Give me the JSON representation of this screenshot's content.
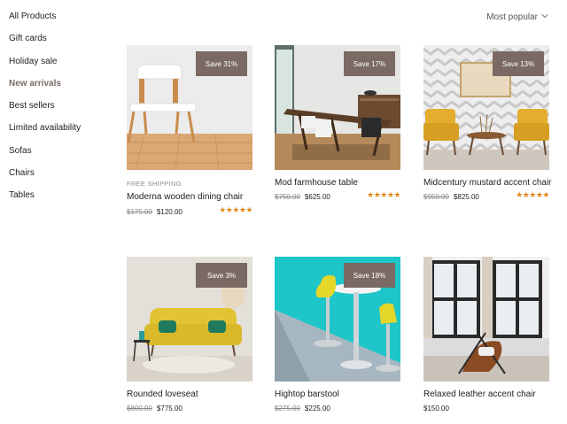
{
  "sidebar": {
    "items": [
      {
        "label": "All Products"
      },
      {
        "label": "Gift cards"
      },
      {
        "label": "Holiday sale"
      },
      {
        "label": "New arrivals"
      },
      {
        "label": "Best sellers"
      },
      {
        "label": "Limited availability"
      },
      {
        "label": "Sofas"
      },
      {
        "label": "Chairs"
      },
      {
        "label": "Tables"
      }
    ],
    "active_index": 3
  },
  "sort": {
    "label": "Most popular",
    "icon": "chevron-down-icon"
  },
  "products": [
    {
      "name": "Moderna wooden dining chair",
      "badge": "Save 31%",
      "shipping": "FREE SHIPPING",
      "old_price": "$175.00",
      "price": "$120.00",
      "rating": 5
    },
    {
      "name": "Mod farmhouse table",
      "badge": "Save 17%",
      "old_price": "$750.00",
      "price": "$625.00",
      "rating": 5
    },
    {
      "name": "Midcentury mustard accent chair",
      "badge": "Save 13%",
      "old_price": "$950.00",
      "price": "$825.00",
      "rating": 5
    },
    {
      "name": "Rounded loveseat",
      "badge": "Save 3%",
      "old_price": "$800.00",
      "price": "$775.00"
    },
    {
      "name": "Hightop barstool",
      "badge": "Save 18%",
      "old_price": "$275.00",
      "price": "$225.00"
    },
    {
      "name": "Relaxed leather accent chair",
      "price": "$150.00"
    }
  ],
  "colors": {
    "accent": "#7a6a63",
    "star": "#e08a1e"
  }
}
